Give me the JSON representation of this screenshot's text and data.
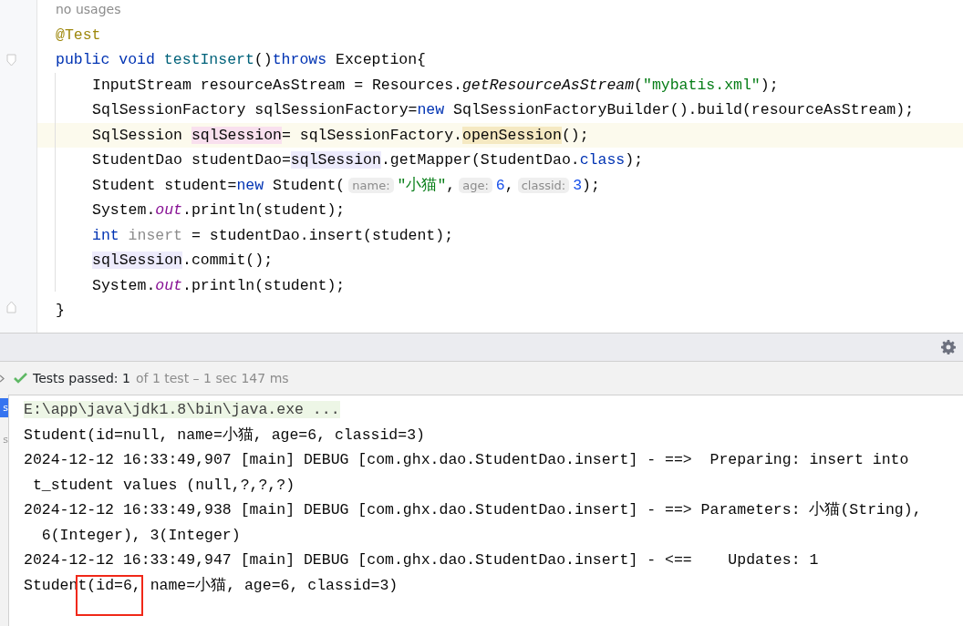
{
  "editor": {
    "lines": [
      {
        "current": false,
        "tokens": [
          {
            "kind": "usage-hint",
            "text": "no usages"
          }
        ]
      },
      {
        "current": false,
        "tokens": [
          {
            "kind": "annotation",
            "text": "@Test"
          }
        ]
      },
      {
        "current": false,
        "tokens": [
          {
            "kind": "keyword",
            "text": "public "
          },
          {
            "kind": "keyword",
            "text": "void "
          },
          {
            "kind": "method-decl",
            "text": "testInsert"
          },
          {
            "kind": "plain",
            "text": "()"
          },
          {
            "kind": "keyword",
            "text": "throws"
          },
          {
            "kind": "plain",
            "text": " Exception{"
          }
        ],
        "children": [
          {
            "current": false,
            "tokens": [
              {
                "kind": "plain",
                "text": "InputStream resourceAsStream = Resources."
              },
              {
                "kind": "static-method",
                "text": "getResourceAsStream"
              },
              {
                "kind": "plain",
                "text": "("
              },
              {
                "kind": "string",
                "text": "\"mybatis.xml\""
              },
              {
                "kind": "plain",
                "text": ");"
              }
            ]
          },
          {
            "current": false,
            "tokens": [
              {
                "kind": "plain",
                "text": "SqlSessionFactory sqlSessionFactory="
              },
              {
                "kind": "keyword",
                "text": "new"
              },
              {
                "kind": "plain",
                "text": " SqlSessionFactoryBuilder().build(resourceAsStream);"
              }
            ]
          },
          {
            "current": true,
            "tokens": [
              {
                "kind": "plain",
                "text": "SqlSession "
              },
              {
                "kind": "write-usage",
                "text": "sqlSession"
              },
              {
                "kind": "plain",
                "text": "= sqlSessionFactory."
              },
              {
                "kind": "match",
                "text": "openSession"
              },
              {
                "kind": "plain",
                "text": "();"
              }
            ]
          },
          {
            "current": false,
            "tokens": [
              {
                "kind": "plain",
                "text": "StudentDao studentDao="
              },
              {
                "kind": "read-usage",
                "text": "sqlSession"
              },
              {
                "kind": "plain",
                "text": ".getMapper(StudentDao."
              },
              {
                "kind": "keyword",
                "text": "class"
              },
              {
                "kind": "plain",
                "text": ");"
              }
            ]
          },
          {
            "current": false,
            "tokens": [
              {
                "kind": "plain",
                "text": "Student student="
              },
              {
                "kind": "keyword",
                "text": "new"
              },
              {
                "kind": "plain",
                "text": " Student("
              },
              {
                "kind": "param-hint",
                "text": "name:"
              },
              {
                "kind": "string",
                "text": "\"小猫\""
              },
              {
                "kind": "plain",
                "text": ","
              },
              {
                "kind": "param-hint",
                "text": "age:"
              },
              {
                "kind": "number",
                "text": "6"
              },
              {
                "kind": "plain",
                "text": ","
              },
              {
                "kind": "param-hint",
                "text": "classid:"
              },
              {
                "kind": "number",
                "text": "3"
              },
              {
                "kind": "plain",
                "text": ");"
              }
            ]
          },
          {
            "current": false,
            "tokens": [
              {
                "kind": "plain",
                "text": "System."
              },
              {
                "kind": "static-field",
                "text": "out"
              },
              {
                "kind": "plain",
                "text": ".println(student);"
              }
            ]
          },
          {
            "current": false,
            "tokens": [
              {
                "kind": "keyword",
                "text": "int "
              },
              {
                "kind": "unused",
                "text": "insert"
              },
              {
                "kind": "plain",
                "text": " = studentDao.insert(student);"
              }
            ]
          },
          {
            "current": false,
            "tokens": [
              {
                "kind": "read-usage",
                "text": "sqlSession"
              },
              {
                "kind": "plain",
                "text": ".commit();"
              }
            ]
          },
          {
            "current": false,
            "tokens": [
              {
                "kind": "plain",
                "text": "System."
              },
              {
                "kind": "static-field",
                "text": "out"
              },
              {
                "kind": "plain",
                "text": ".println(student);"
              }
            ]
          }
        ]
      },
      {
        "current": false,
        "tokens": [
          {
            "kind": "plain",
            "text": "}"
          }
        ]
      }
    ]
  },
  "test_status": {
    "passed": true,
    "label": "Tests passed:",
    "count": "1",
    "detail": "of 1 test – 1 sec 147 ms"
  },
  "side_tabs": [
    {
      "text": "s",
      "selected": true
    },
    {
      "text": "s",
      "selected": false
    }
  ],
  "console": [
    {
      "kind": "command",
      "segments": [
        {
          "text": "E:\\app\\java\\jdk1.8\\bin\\java.exe ...",
          "boxed": false
        }
      ]
    },
    {
      "kind": "output",
      "segments": [
        {
          "text": "Student(id=null, name=小猫, age=6, classid=3)",
          "boxed": false
        }
      ]
    },
    {
      "kind": "output",
      "segments": [
        {
          "text": "2024-12-12 16:33:49,907 [main] DEBUG [com.ghx.dao.StudentDao.insert] - ==>  Preparing: insert into",
          "boxed": false
        }
      ]
    },
    {
      "kind": "output",
      "segments": [
        {
          "text": " t_student values (null,?,?,?)",
          "boxed": false
        }
      ]
    },
    {
      "kind": "output",
      "segments": [
        {
          "text": "2024-12-12 16:33:49,938 [main] DEBUG [com.ghx.dao.StudentDao.insert] - ==> Parameters: 小猫(String),",
          "boxed": false
        }
      ]
    },
    {
      "kind": "output",
      "segments": [
        {
          "text": "  6(Integer), 3(Integer)",
          "boxed": false
        }
      ]
    },
    {
      "kind": "output",
      "segments": [
        {
          "text": "2024-12-12 16:33:49,947 [main] DEBUG [com.ghx.dao.StudentDao.insert] - <==    Updates: 1",
          "boxed": false
        }
      ]
    },
    {
      "kind": "output",
      "segments": [
        {
          "text": "Studen",
          "boxed": false
        },
        {
          "text": "t(id=6,",
          "boxed": true
        },
        {
          "text": " name=小猫, age=6, classid=3)",
          "boxed": false
        }
      ]
    }
  ]
}
